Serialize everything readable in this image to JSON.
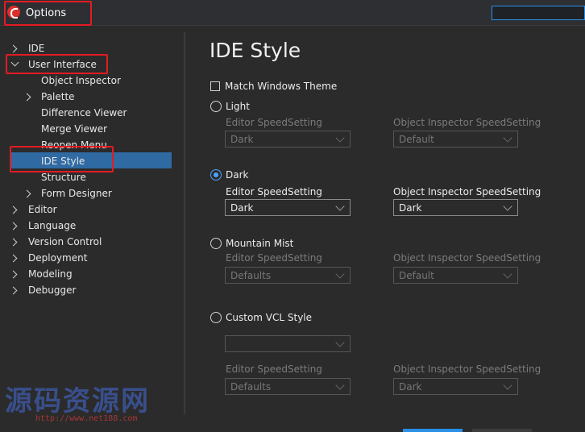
{
  "window": {
    "title": "Options",
    "search_value": ""
  },
  "tree": [
    {
      "label": "IDE",
      "level": 0,
      "expander": "right"
    },
    {
      "label": "User Interface",
      "level": 0,
      "expander": "down"
    },
    {
      "label": "Object Inspector",
      "level": 1,
      "expander": ""
    },
    {
      "label": "Palette",
      "level": 1,
      "expander": "right"
    },
    {
      "label": "Difference Viewer",
      "level": 1,
      "expander": ""
    },
    {
      "label": "Merge Viewer",
      "level": 1,
      "expander": ""
    },
    {
      "label": "Reopen Menu",
      "level": 1,
      "expander": ""
    },
    {
      "label": "IDE Style",
      "level": 1,
      "expander": "",
      "selected": true
    },
    {
      "label": "Structure",
      "level": 1,
      "expander": ""
    },
    {
      "label": "Form Designer",
      "level": 1,
      "expander": "right"
    },
    {
      "label": "Editor",
      "level": 0,
      "expander": "right"
    },
    {
      "label": "Language",
      "level": 0,
      "expander": "right"
    },
    {
      "label": "Version Control",
      "level": 0,
      "expander": "right"
    },
    {
      "label": "Deployment",
      "level": 0,
      "expander": "right"
    },
    {
      "label": "Modeling",
      "level": 0,
      "expander": "right"
    },
    {
      "label": "Debugger",
      "level": 0,
      "expander": "right"
    }
  ],
  "content": {
    "title": "IDE Style",
    "match_windows_theme": "Match Windows Theme",
    "editor_label": "Editor SpeedSetting",
    "inspector_label": "Object Inspector SpeedSetting",
    "styles": [
      {
        "label": "Light",
        "selected": false,
        "editor_value": "Dark",
        "inspector_value": "Default"
      },
      {
        "label": "Dark",
        "selected": true,
        "editor_value": "Dark",
        "inspector_value": "Dark"
      },
      {
        "label": "Mountain Mist",
        "selected": false,
        "editor_value": "Defaults",
        "inspector_value": "Default"
      },
      {
        "label": "Custom VCL Style",
        "selected": false,
        "custom_value": "",
        "editor_value": "Defaults",
        "inspector_value": "Dark"
      }
    ]
  },
  "watermark": {
    "text": "源码资源网",
    "url": "http://www.net188.com"
  },
  "colors": {
    "accent": "#2f6aa3",
    "highlight": "#e31b23",
    "focus": "#2a8fe6"
  }
}
